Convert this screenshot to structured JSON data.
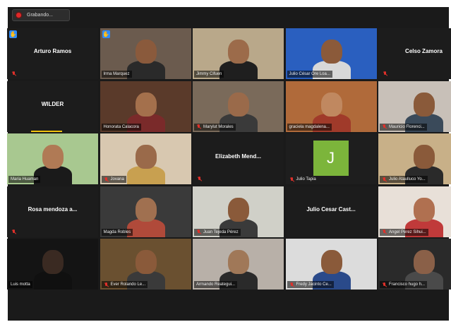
{
  "recording": {
    "label": "Grabando..."
  },
  "tiles": [
    {
      "id": "t1",
      "name": "Arturo Ramos",
      "mode": "name",
      "hand": true,
      "muted": true
    },
    {
      "id": "t2",
      "name": "Irma Marquez",
      "mode": "video",
      "hand": true,
      "active": true,
      "muted": false,
      "bg": "#6b5b4e",
      "skin": "#8a5a3c",
      "shirt": "#2a2a2a"
    },
    {
      "id": "t3",
      "name": "Jimmy Cifuen",
      "mode": "video",
      "muted": false,
      "bg": "#b9a88a",
      "skin": "#9c6b4a",
      "shirt": "#1f1f1f"
    },
    {
      "id": "t4",
      "name": "Julio César Ore Loa...",
      "mode": "video",
      "muted": false,
      "bg": "#2a5fbf",
      "skin": "#8b5a3a",
      "shirt": "#d8d8d8"
    },
    {
      "id": "t5",
      "name": "Celso Zamora",
      "mode": "name",
      "muted": true
    },
    {
      "id": "t6",
      "name": "WILDER",
      "mode": "name",
      "muted": false,
      "speaking": true
    },
    {
      "id": "t7",
      "name": "Honorata Calacora",
      "mode": "video",
      "muted": false,
      "bg": "#5a3a2a",
      "skin": "#a4704c",
      "shirt": "#7a2a2a"
    },
    {
      "id": "t8",
      "name": "Marylut Morales",
      "mode": "video",
      "muted": true,
      "bg": "#7a6a5a",
      "skin": "#9a6a4a",
      "shirt": "#3a3a3a"
    },
    {
      "id": "t9",
      "name": "graciela magdalena...",
      "mode": "video",
      "muted": false,
      "bg": "#b06a3a",
      "skin": "#c08860",
      "shirt": "#a03a2a"
    },
    {
      "id": "t10",
      "name": "Mauricio Florenci...",
      "mode": "video",
      "muted": true,
      "bg": "#c8c0b8",
      "skin": "#8a5a3a",
      "shirt": "#3a4a5a"
    },
    {
      "id": "t11",
      "name": "Maria Huaman",
      "mode": "video",
      "muted": false,
      "bg": "#a8c890",
      "skin": "#b07a55",
      "shirt": "#1a1a1a"
    },
    {
      "id": "t12",
      "name": "Jovana",
      "mode": "video",
      "muted": true,
      "bg": "#d8c8b0",
      "skin": "#9a6a4a",
      "shirt": "#c8a050"
    },
    {
      "id": "t13",
      "name": "Elizabeth Mend...",
      "mode": "name",
      "muted": true
    },
    {
      "id": "t14",
      "name": "Julio Tapia",
      "mode": "avatar",
      "initial": "J",
      "muted": true
    },
    {
      "id": "t15",
      "name": "Julio Ataulluco Yo...",
      "mode": "video",
      "muted": true,
      "bg": "#c8b088",
      "skin": "#8a5a3a",
      "shirt": "#2a2a2a"
    },
    {
      "id": "t16",
      "name": "Rosa mendoza a...",
      "mode": "name",
      "muted": true
    },
    {
      "id": "t17",
      "name": "Magda Robles",
      "mode": "video",
      "muted": false,
      "bg": "#3a3a3a",
      "skin": "#a07050",
      "shirt": "#b04a3a"
    },
    {
      "id": "t18",
      "name": "Juan Tejeda Pérez",
      "mode": "video",
      "muted": true,
      "bg": "#d0d0c8",
      "skin": "#8a5a3a",
      "shirt": "#3a3a3a"
    },
    {
      "id": "t19",
      "name": "Julio Cesar Cast...",
      "mode": "name",
      "muted": false
    },
    {
      "id": "t20",
      "name": "Angel Perez Sihui...",
      "mode": "video",
      "muted": true,
      "bg": "#e8e0d8",
      "skin": "#b07050",
      "shirt": "#c03a3a"
    },
    {
      "id": "t21",
      "name": "Luis motta",
      "mode": "video",
      "muted": false,
      "bg": "#141414",
      "skin": "#3a2a22",
      "shirt": "#101010"
    },
    {
      "id": "t22",
      "name": "Ever Rolando Le...",
      "mode": "video",
      "muted": true,
      "bg": "#6a5030",
      "skin": "#8a5a3a",
      "shirt": "#3a3a3a"
    },
    {
      "id": "t23",
      "name": "Armando Reategui...",
      "mode": "video",
      "muted": false,
      "bg": "#b8b0a8",
      "skin": "#a07858",
      "shirt": "#2a2a2a"
    },
    {
      "id": "t24",
      "name": "Fredy Jacinto Ce...",
      "mode": "video",
      "muted": true,
      "bg": "#dcdcdc",
      "skin": "#8a5a3a",
      "shirt": "#2a4a8a"
    },
    {
      "id": "t25",
      "name": "Francisco hugo h...",
      "mode": "video",
      "muted": true,
      "bg": "#2a2a2a",
      "skin": "#8a6048",
      "shirt": "#4a4a4a"
    }
  ]
}
